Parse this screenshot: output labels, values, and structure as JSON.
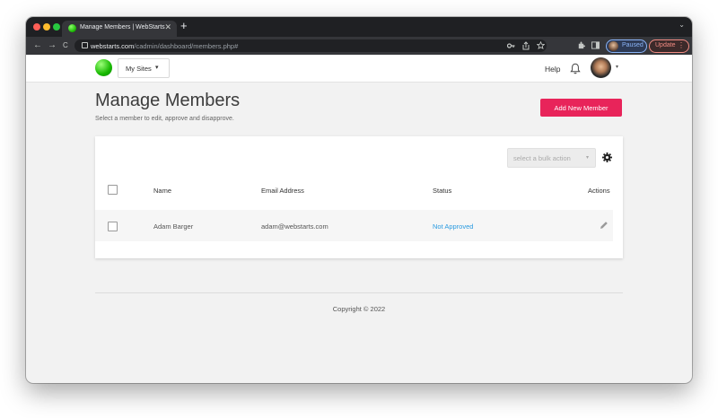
{
  "browser": {
    "tab_title": "Manage Members | WebStarts",
    "tab_close": "✕",
    "new_tab": "+",
    "tab_search": "⌄",
    "url_domain": "webstarts.com",
    "url_path": "/cadmin/dashboard/members.php#",
    "profile_label": "Paused",
    "update_label": "Update",
    "update_menu": "⋮",
    "nav_back": "←",
    "nav_forward": "→",
    "nav_reload": "C",
    "colors": {
      "tabstrip": "#1f2023",
      "toolbar": "#35363a",
      "profile": "#8ab4f8",
      "update": "#f28b82"
    }
  },
  "header": {
    "sites_label": "My Sites",
    "sites_chevron": "▾",
    "help_label": "Help",
    "user_caret": "▾",
    "logo_color": "#17b800"
  },
  "page": {
    "title": "Manage Members",
    "subtitle": "Select a member to edit, approve and disapprove.",
    "add_button": "Add New Member",
    "accent_color": "#e8245a"
  },
  "table": {
    "bulk_placeholder": "select a bulk action",
    "bulk_caret": "▾",
    "columns": [
      "Name",
      "Email Address",
      "Status",
      "Actions"
    ],
    "rows": [
      {
        "name": "Adam Barger",
        "email": "adam@webstarts.com",
        "status": "Not Approved"
      }
    ],
    "status_color": "#2b9be0"
  },
  "footer": {
    "copyright": "Copyright © 2022"
  }
}
